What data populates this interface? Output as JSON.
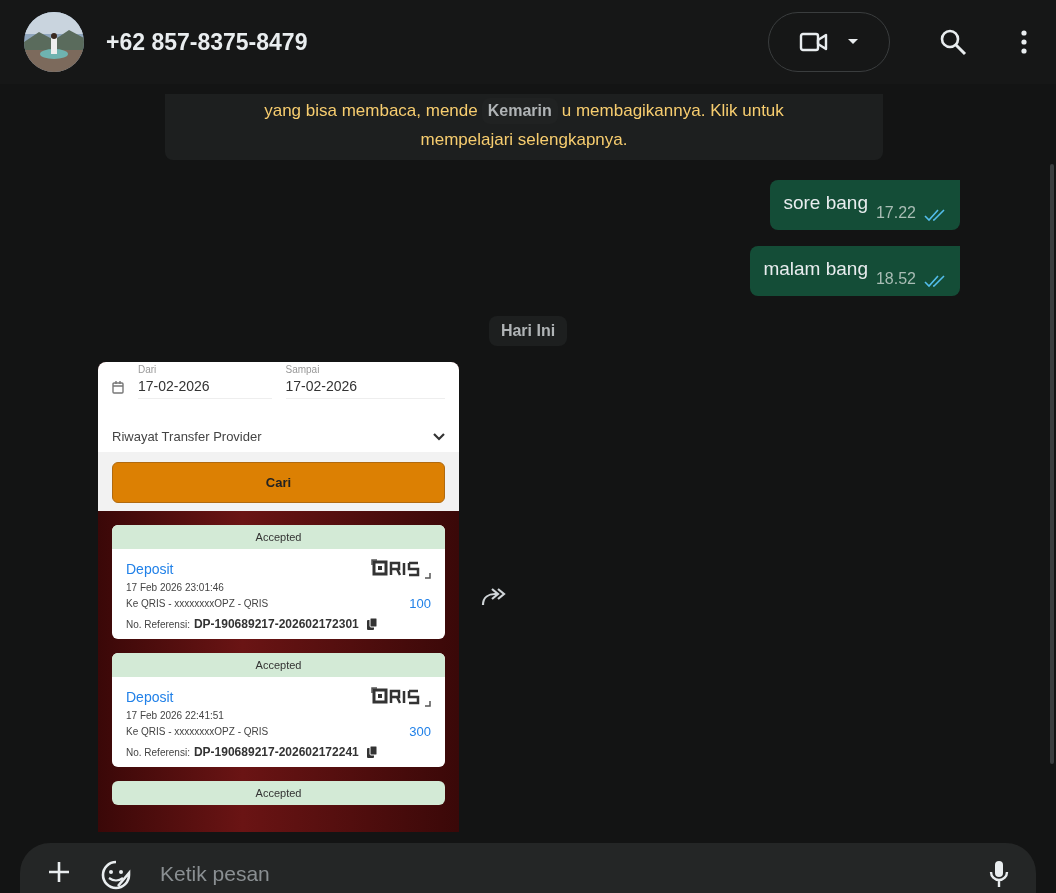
{
  "header": {
    "contact_name": "+62 857-8375-8479"
  },
  "notice": {
    "line_start": "yang bisa membaca, mende",
    "line_end": "u membagikannya. Klik untuk",
    "last_line": "mempelajari selengkapnya."
  },
  "date_chips": [
    "Kemarin",
    "Hari Ini"
  ],
  "messages": [
    {
      "text": "sore bang",
      "time": "17.22",
      "read": true
    },
    {
      "text": "malam bang",
      "time": "18.52",
      "read": true
    }
  ],
  "image_message": {
    "from_label": "Dari",
    "to_label": "Sampai",
    "from_date": "17-02-2026",
    "to_date": "17-02-2026",
    "dropdown": "Riwayat Transfer Provider",
    "button": "Cari",
    "transactions": [
      {
        "status": "Accepted",
        "type": "Deposit",
        "datetime": "17 Feb 2026 23:01:46",
        "destination": "Ke QRIS - xxxxxxxxOPZ - QRIS",
        "amount": "100",
        "ref_label": "No. Referensi:",
        "ref": "DP-190689217-202602172301"
      },
      {
        "status": "Accepted",
        "type": "Deposit",
        "datetime": "17 Feb 2026 22:41:51",
        "destination": "Ke QRIS - xxxxxxxxOPZ - QRIS",
        "amount": "300",
        "ref_label": "No. Referensi:",
        "ref": "DP-190689217-202602172241"
      },
      {
        "status": "Accepted"
      }
    ]
  },
  "composer": {
    "placeholder": "Ketik pesan"
  }
}
